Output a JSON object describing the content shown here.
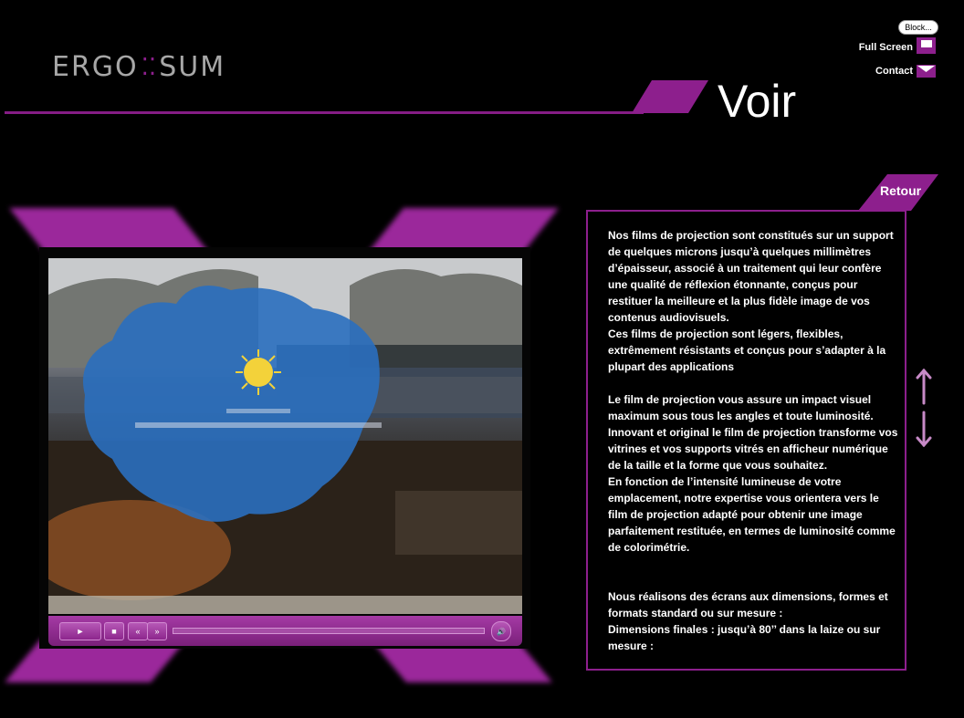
{
  "logo": {
    "left": "ERGO",
    "dots": "⁚⁚",
    "right": "SUM"
  },
  "header": {
    "title": "Voir"
  },
  "top_controls": {
    "block_label": "Block...",
    "fullscreen_label": "Full Screen",
    "contact_label": "Contact"
  },
  "video": {
    "play_glyph": "►",
    "stop_glyph": "■",
    "rewind_glyph": "«",
    "forward_glyph": "»",
    "volume_glyph": "🔊"
  },
  "panel": {
    "retour_label": "Retour",
    "paragraphs": [
      "Nos films de projection sont constitués sur un support de quelques microns jusqu’à quelques millimètres d’épaisseur, associé à un traitement qui leur confère une qualité de réflexion étonnante, conçus pour restituer la meilleure et la plus fidèle image de vos contenus audiovisuels.",
      "Ces films de projection sont légers, flexibles, extrêmement résistants et conçus pour s’adapter à la plupart des applications",
      "Le film de projection vous assure un impact visuel maximum sous tous les angles et toute luminosité. Innovant et original le film de projection transforme vos vitrines et vos supports vitrés en afficheur numérique de la taille et la forme que vous souhaitez.",
      "En fonction de l’intensité lumineuse de votre emplacement, notre expertise vous orientera vers le film de projection adapté pour obtenir une image parfaitement restituée, en termes de luminosité comme de colorimétrie.",
      "Nous réalisons des écrans aux dimensions, formes et formats standard ou sur mesure :",
      "Dimensions finales : jusqu’à 80’’ dans la laize ou sur mesure :"
    ]
  },
  "colors": {
    "accent": "#8d1f8d",
    "background": "#000000",
    "text": "#ffffff",
    "logo_gray": "#a7a7a7"
  }
}
